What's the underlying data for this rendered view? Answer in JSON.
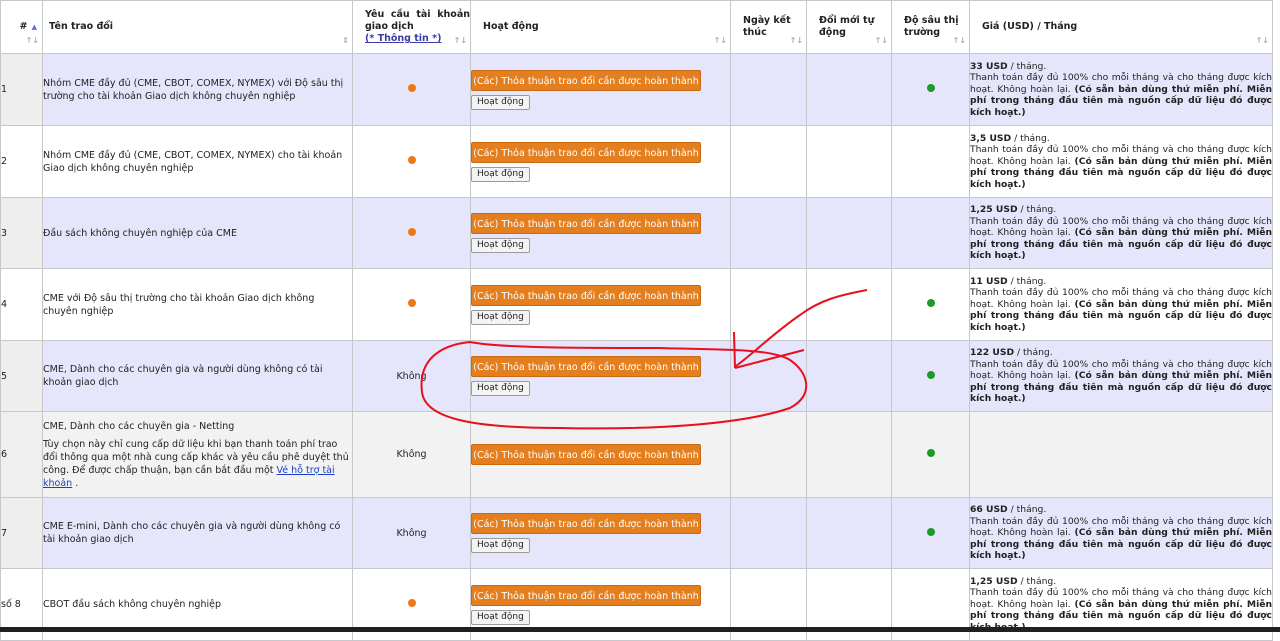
{
  "header": {
    "num": "#",
    "name": "Tên trao đổi",
    "req_line1": "Yêu cầu tài khoản giao dịch",
    "req_info": "(* Thông tin *)",
    "activity": "Hoạt động",
    "end_date": "Ngày kết thúc",
    "auto_renew": "Đổi mới tự động",
    "depth": "Độ sâu thị trường",
    "price": "Giá (USD) / Tháng"
  },
  "common": {
    "agree_label": "(Các) Thỏa thuận trao đổi cần được hoàn thành",
    "activate_label": "Hoạt động",
    "per_month": "/ tháng.",
    "price_text": "Thanh toán đầy đủ 100% cho mỗi tháng và cho tháng được kích hoạt. Không hoàn lại.",
    "price_bold": "(Có sẵn bản dùng thứ miễn phí. Miễn phí trong tháng đầu tiên mà nguồn cấp dữ liệu đó được kích hoạt.)",
    "colors": {
      "orange": "#e47f1f",
      "green_dot": "#1e9a2a",
      "orange_dot": "#ea7b14",
      "row_purple": "#e5e6fb",
      "annotation": "#e8101c"
    }
  },
  "rows": [
    {
      "num": "1",
      "name": "Nhóm CME đầy đủ (CME, CBOT, COMEX, NYMEX) với Độ sâu thị trường cho tài khoản Giao dịch không chuyên nghiệp",
      "req": "dot",
      "price": "33 USD"
    },
    {
      "num": "2",
      "name": "Nhóm CME đầy đủ (CME, CBOT, COMEX, NYMEX) cho tài khoản Giao dịch không chuyên nghiệp",
      "req": "dot",
      "price": "3,5 USD"
    },
    {
      "num": "3",
      "name": "Đầu sách không chuyên nghiệp của CME",
      "req": "dot",
      "price": "1,25 USD"
    },
    {
      "num": "4",
      "name": "CME với Độ sâu thị trường cho tài khoản Giao dịch không chuyên nghiệp",
      "req": "dot",
      "price": "11 USD"
    },
    {
      "num": "5",
      "name": "CME, Dành cho các chuyên gia và người dùng không có tài khoản giao dịch",
      "req": "Không",
      "price": "122 USD"
    },
    {
      "num": "6",
      "name": "CME, Dành cho các chuyên gia - Netting",
      "note": "Tùy chọn này chỉ cung cấp dữ liệu khi bạn thanh toán phí trao đổi thông qua một nhà cung cấp khác và yêu cầu phê duyệt thủ công. Để được chấp thuận, bạn cần bắt đầu một",
      "note_link": "Vé hỗ trợ tài khoản",
      "note_end": ".",
      "req": "Không"
    },
    {
      "num": "7",
      "name": "CME E-mini, Dành cho các chuyên gia và người dùng không có tài khoản giao dịch",
      "req": "Không",
      "price": "66 USD"
    },
    {
      "num": "số 8",
      "name": "CBOT đầu sách không chuyên nghiệp",
      "req": "dot",
      "price": "1,25 USD"
    }
  ]
}
